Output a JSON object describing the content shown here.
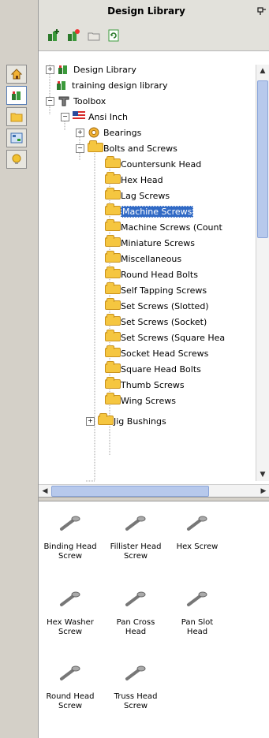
{
  "panel": {
    "title": "Design Library"
  },
  "toolbar": {
    "icons": [
      "add-file-location-icon",
      "create-new-folder-icon",
      "open-folder-icon",
      "refresh-icon"
    ]
  },
  "left_rail": {
    "icons": [
      "home-icon",
      "design-library-icon",
      "file-explorer-icon",
      "view-palette-icon",
      "appearances-icon"
    ]
  },
  "tree": {
    "items": [
      {
        "label": "Design Library"
      },
      {
        "label": "training design library"
      },
      {
        "label": "Toolbox"
      },
      {
        "label": "Ansi Inch"
      },
      {
        "label": "Bearings"
      },
      {
        "label": "Bolts and Screws"
      },
      {
        "label": "Countersunk Head"
      },
      {
        "label": "Hex Head"
      },
      {
        "label": "Lag Screws"
      },
      {
        "label": "Machine Screws"
      },
      {
        "label": "Machine Screws (Count"
      },
      {
        "label": "Miniature Screws"
      },
      {
        "label": "Miscellaneous"
      },
      {
        "label": "Round Head Bolts"
      },
      {
        "label": "Self Tapping Screws"
      },
      {
        "label": "Set Screws (Slotted)"
      },
      {
        "label": "Set Screws (Socket)"
      },
      {
        "label": "Set Screws (Square Hea"
      },
      {
        "label": "Socket Head Screws"
      },
      {
        "label": "Square Head Bolts"
      },
      {
        "label": "Thumb Screws"
      },
      {
        "label": "Wing Screws"
      },
      {
        "label": "Jig Bushings"
      }
    ],
    "selected": "Machine Screws"
  },
  "palette": {
    "items": [
      {
        "line1": "Binding Head",
        "line2": "Screw"
      },
      {
        "line1": "Fillister Head",
        "line2": "Screw"
      },
      {
        "line1": "Hex Screw",
        "line2": ""
      },
      {
        "line1": "Hex Washer",
        "line2": "Screw"
      },
      {
        "line1": "Pan Cross",
        "line2": "Head"
      },
      {
        "line1": "Pan Slot",
        "line2": "Head"
      },
      {
        "line1": "Round Head",
        "line2": "Screw"
      },
      {
        "line1": "Truss Head",
        "line2": "Screw"
      }
    ]
  },
  "colors": {
    "selection": "#316ac5",
    "folder": "#f5c640",
    "scroll_thumb": "#b7c9ec"
  }
}
